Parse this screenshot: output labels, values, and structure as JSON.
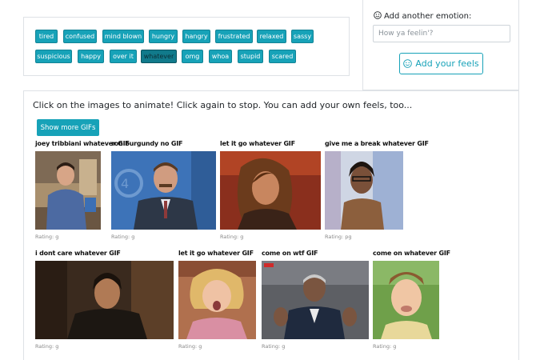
{
  "tags": [
    {
      "label": "tired",
      "active": false
    },
    {
      "label": "confused",
      "active": false
    },
    {
      "label": "mind blown",
      "active": false
    },
    {
      "label": "hungry",
      "active": false
    },
    {
      "label": "hangry",
      "active": false
    },
    {
      "label": "frustrated",
      "active": false
    },
    {
      "label": "relaxed",
      "active": false
    },
    {
      "label": "sassy",
      "active": false
    },
    {
      "label": "suspicious",
      "active": false
    },
    {
      "label": "happy",
      "active": false
    },
    {
      "label": "over it",
      "active": false
    },
    {
      "label": "whatever",
      "active": true
    },
    {
      "label": "omg",
      "active": false
    },
    {
      "label": "whoa",
      "active": false
    },
    {
      "label": "stupid",
      "active": false
    },
    {
      "label": "scared",
      "active": false
    }
  ],
  "add_form": {
    "label": "Add another emotion:",
    "placeholder": "How ya feelin'?",
    "value": "",
    "button_label": "Add your feels",
    "icon": "smiley-icon"
  },
  "main": {
    "instructions": "Click on the images to animate! Click again to stop. You can add your own feels, too...",
    "more_button_label": "Show more GIFs"
  },
  "gifs": [
    {
      "title": "joey tribbiani whatever GIF",
      "rating": "Rating: g"
    },
    {
      "title": "ron burgundy no GIF",
      "rating": "Rating: g"
    },
    {
      "title": "let it go whatever GIF",
      "rating": "Rating: g"
    },
    {
      "title": "give me a break whatever GIF",
      "rating": "Rating: pg"
    },
    {
      "title": "i dont care whatever GIF",
      "rating": "Rating: g"
    },
    {
      "title": "let it go whatever GIF",
      "rating": "Rating: g"
    },
    {
      "title": "come on wtf GIF",
      "rating": "Rating: g"
    },
    {
      "title": "come on whatever GIF",
      "rating": "Rating: g"
    }
  ],
  "colors": {
    "accent": "#17a2b8",
    "accent_active": "#117a8b",
    "border": "#dee2e6"
  }
}
